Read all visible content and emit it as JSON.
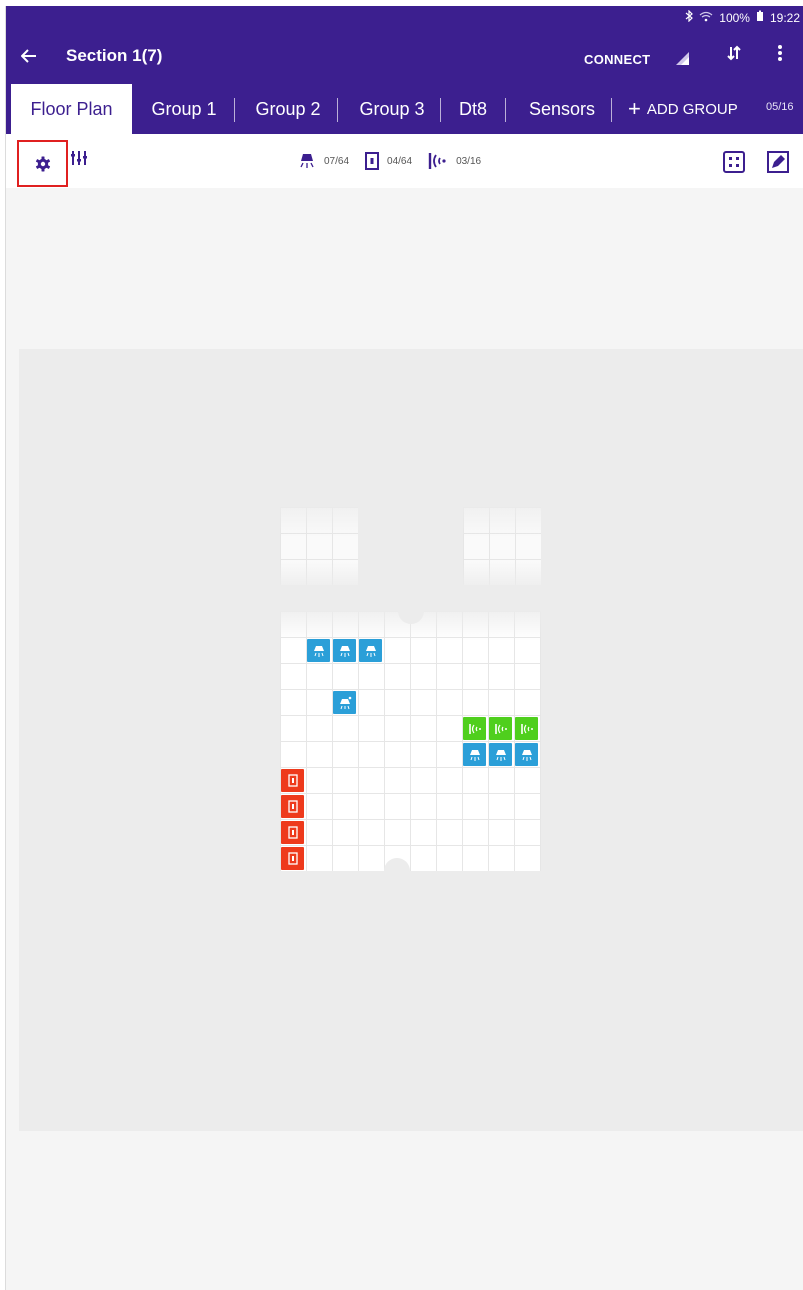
{
  "status_bar": {
    "bluetooth_icon": "bluetooth-icon",
    "wifi_icon": "wifi-icon",
    "battery_text": "100%",
    "battery_icon": "battery-icon",
    "time": "19:22"
  },
  "app_bar": {
    "back_icon": "arrow-left-icon",
    "title": "Section 1(7)",
    "connect_label": "CONNECT",
    "signal_icon": "signal-icon",
    "sort_icon": "sort-arrows-icon",
    "more_icon": "more-vertical-icon"
  },
  "tabs": {
    "items": [
      {
        "label": "Floor Plan",
        "active": true
      },
      {
        "label": "Group 1",
        "active": false
      },
      {
        "label": "Group 2",
        "active": false
      },
      {
        "label": "Group 3",
        "active": false
      },
      {
        "label": "Dt8",
        "active": false
      },
      {
        "label": "Sensors",
        "active": false
      }
    ],
    "add_group_label": "ADD GROUP",
    "group_count": "05/16"
  },
  "toolbar": {
    "settings_icon": "gear-icon",
    "tune_icon": "sliders-icon",
    "light_icon": "ceiling-light-icon",
    "light_count": "07/64",
    "switch_icon": "wall-switch-icon",
    "switch_count": "04/64",
    "sensor_icon": "motion-sensor-icon",
    "sensor_count": "03/16",
    "fit_icon": "fit-screen-icon",
    "edit_icon": "edit-icon"
  },
  "floor_plan": {
    "colors": {
      "light": "#2b9fd8",
      "sensor": "#4fcf1d",
      "switch": "#ee3a1c",
      "accent": "#3c1f8f",
      "highlight_border": "#e02020"
    },
    "device_types": [
      "light",
      "sensor",
      "switch"
    ]
  }
}
